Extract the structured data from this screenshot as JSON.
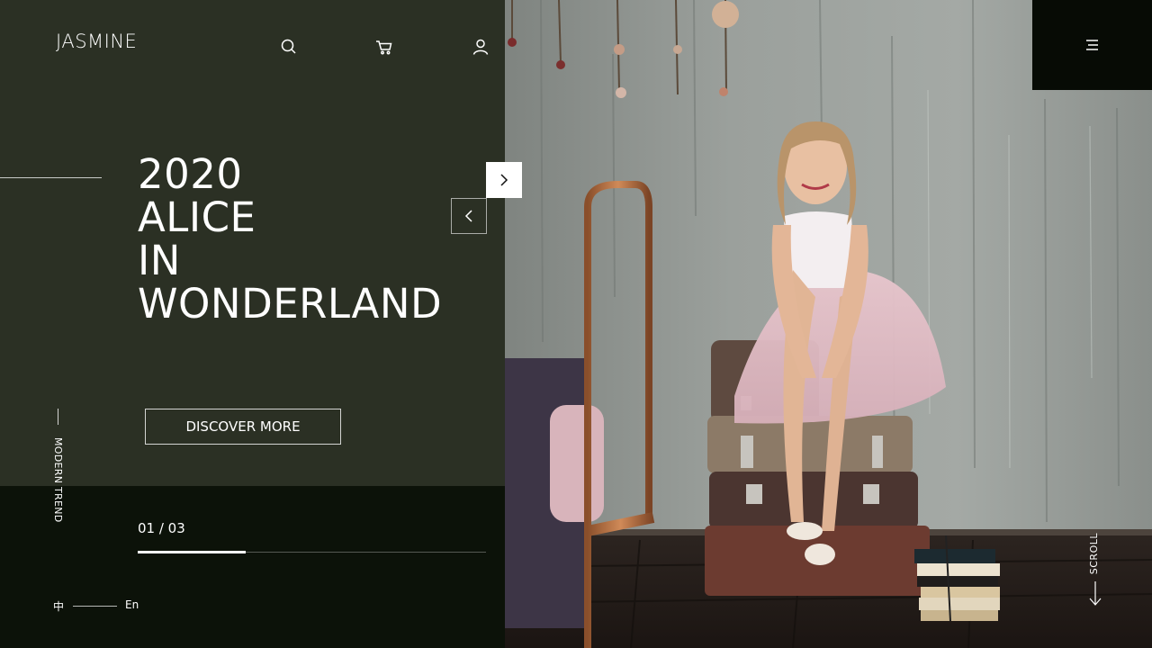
{
  "brand": {
    "logo": "JASMINE"
  },
  "nav": {
    "icons": [
      "search-icon",
      "cart-icon",
      "user-icon",
      "menu-icon"
    ]
  },
  "hero": {
    "title_lines": [
      "2020",
      "ALICE",
      "IN",
      "WONDERLAND"
    ],
    "cta_label": "DISCOVER MORE",
    "side_label": "MODERN TREND"
  },
  "slider": {
    "counter": "01 / 03",
    "current": 1,
    "total": 3,
    "progress_fraction": 0.31
  },
  "language": {
    "zh": "中",
    "en": "En"
  },
  "scroll": {
    "label": "SCROLL"
  },
  "colors": {
    "panel": "#2b3024",
    "panel_dark": "#0c1209",
    "menu_box": "#070b05",
    "text": "#ffffff"
  }
}
